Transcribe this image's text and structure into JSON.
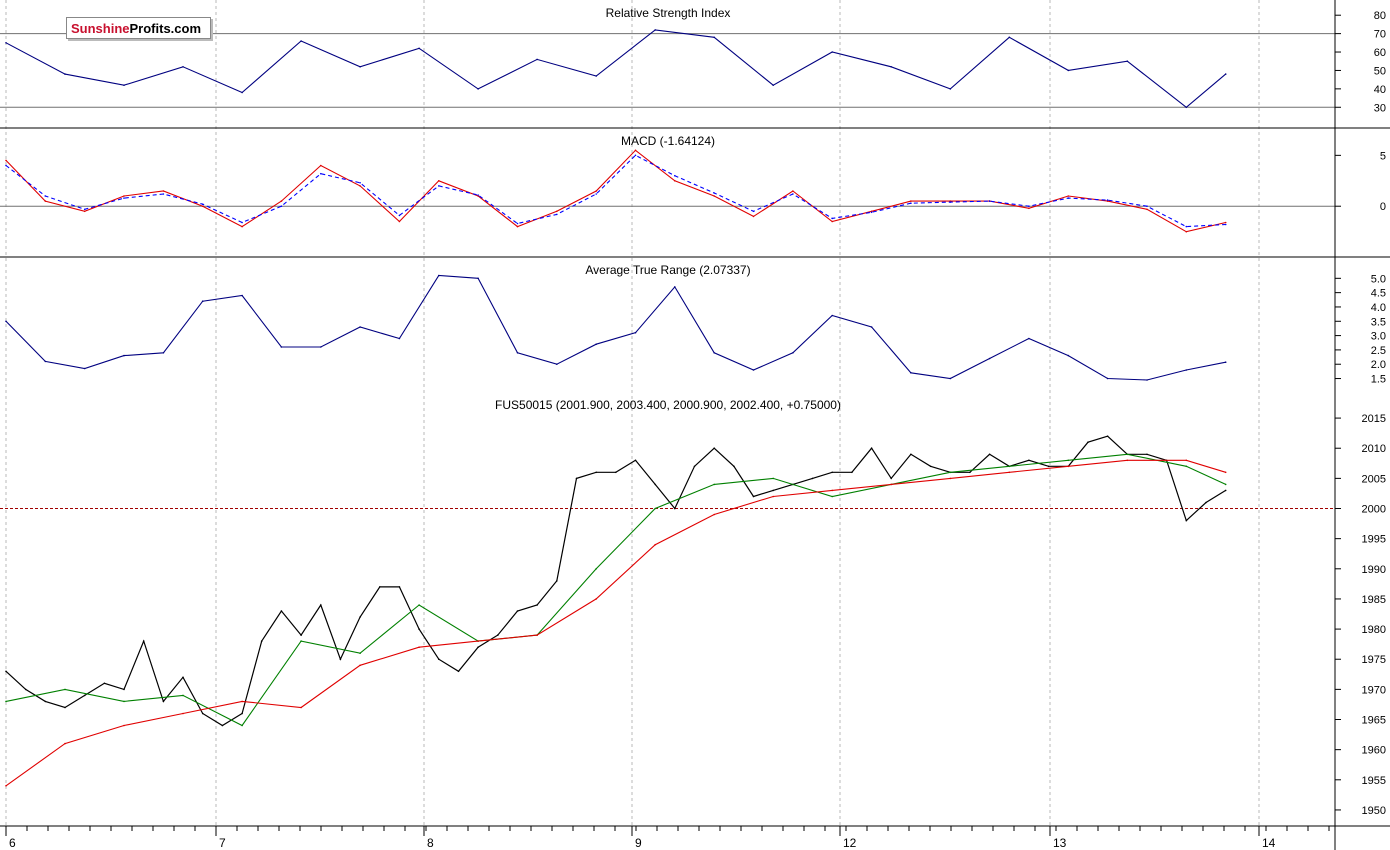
{
  "brand": {
    "part1": "Sunshine",
    "part2": "Profits.com"
  },
  "colors": {
    "price": "#000000",
    "sma_fast": "#008000",
    "sma_slow": "#e00000",
    "indicator": "#000080",
    "signal": "#0000ff",
    "grid": "#b8b8b8",
    "ref": "#707070",
    "hline": "#a00000"
  },
  "x_axis": {
    "labels": [
      "6",
      "7",
      "8",
      "9",
      "12",
      "13",
      "14"
    ]
  },
  "chart_data": [
    {
      "type": "line",
      "title": "Relative Strength Index",
      "ylim": [
        22,
        85
      ],
      "yticks": [
        30,
        40,
        50,
        60,
        70,
        80
      ],
      "reference_lines": [
        30,
        70
      ],
      "x": [
        0,
        3,
        6,
        9,
        12,
        15,
        18,
        21,
        24,
        27,
        30,
        33,
        36,
        39,
        42,
        45,
        48,
        51,
        54,
        57,
        60,
        62
      ],
      "values": [
        65,
        48,
        42,
        52,
        38,
        66,
        52,
        62,
        40,
        56,
        47,
        72,
        68,
        42,
        60,
        52,
        40,
        68,
        50,
        55,
        30,
        48
      ]
    },
    {
      "type": "line",
      "title": "MACD (-1.64124)",
      "ylim": [
        -4.5,
        7
      ],
      "yticks": [
        0,
        5
      ],
      "reference_lines": [
        0
      ],
      "series": [
        {
          "x": [
            0,
            2,
            4,
            6,
            8,
            10,
            12,
            14,
            16,
            18,
            20,
            22,
            24,
            26,
            28,
            30,
            32,
            34,
            36,
            38,
            40,
            42,
            44,
            46,
            48,
            50,
            52,
            54,
            56,
            58,
            60,
            62
          ],
          "values": [
            4.5,
            0.5,
            -0.5,
            1,
            1.5,
            0,
            -2,
            0.5,
            4,
            2,
            -1.5,
            2.5,
            1,
            -2,
            -0.5,
            1.5,
            5.5,
            2.5,
            1,
            -1,
            1.5,
            -1.5,
            -0.5,
            0.5,
            0.5,
            0.5,
            -0.2,
            1,
            0.5,
            -0.3,
            -2.5,
            -1.6
          ]
        },
        {
          "x": [
            0,
            2,
            4,
            6,
            8,
            10,
            12,
            14,
            16,
            18,
            20,
            22,
            24,
            26,
            28,
            30,
            32,
            34,
            36,
            38,
            40,
            42,
            44,
            46,
            48,
            50,
            52,
            54,
            56,
            58,
            60,
            62
          ],
          "values": [
            4,
            1,
            -0.3,
            0.8,
            1.2,
            0.2,
            -1.6,
            0,
            3.2,
            2.3,
            -0.9,
            2,
            1.1,
            -1.7,
            -0.8,
            1.2,
            5,
            3,
            1.3,
            -0.5,
            1.2,
            -1.2,
            -0.6,
            0.3,
            0.4,
            0.5,
            0,
            0.8,
            0.6,
            0,
            -2,
            -1.8
          ]
        }
      ]
    },
    {
      "type": "line",
      "title": "Average True Range (2.07337)",
      "ylim": [
        1.1,
        5.5
      ],
      "yticks": [
        1.5,
        2.0,
        2.5,
        3.0,
        3.5,
        4.0,
        4.5,
        5.0
      ],
      "x": [
        0,
        2,
        4,
        6,
        8,
        10,
        12,
        14,
        16,
        18,
        20,
        22,
        24,
        26,
        28,
        30,
        32,
        34,
        36,
        38,
        40,
        42,
        44,
        46,
        48,
        50,
        52,
        54,
        56,
        58,
        60,
        62
      ],
      "values": [
        3.5,
        2.1,
        1.85,
        2.3,
        2.4,
        4.2,
        4.4,
        2.6,
        2.6,
        3.3,
        2.9,
        5.1,
        5.0,
        2.4,
        2.0,
        2.7,
        3.1,
        4.7,
        2.4,
        1.8,
        2.4,
        3.7,
        3.3,
        1.7,
        1.5,
        2.2,
        2.9,
        2.3,
        1.5,
        1.45,
        1.8,
        2.07
      ]
    },
    {
      "type": "line",
      "title": "FUS50015 (2001.900, 2003.400, 2000.900, 2002.400, +0.75000)",
      "ylim": [
        1948,
        2018
      ],
      "yticks": [
        1950,
        1955,
        1960,
        1965,
        1970,
        1975,
        1980,
        1985,
        1990,
        1995,
        2000,
        2005,
        2010,
        2015
      ],
      "reference_lines": [
        2000
      ],
      "series": [
        {
          "x": [
            0,
            1,
            2,
            3,
            4,
            5,
            6,
            7,
            8,
            9,
            10,
            11,
            12,
            13,
            14,
            15,
            16,
            17,
            18,
            19,
            20,
            21,
            22,
            23,
            24,
            25,
            26,
            27,
            28,
            29,
            30,
            31,
            32,
            33,
            34,
            35,
            36,
            37,
            38,
            39,
            40,
            41,
            42,
            43,
            44,
            45,
            46,
            47,
            48,
            49,
            50,
            51,
            52,
            53,
            54,
            55,
            56,
            57,
            58,
            59,
            60,
            61,
            62
          ],
          "values": [
            1973,
            1970,
            1968,
            1967,
            1969,
            1971,
            1970,
            1978,
            1968,
            1972,
            1966,
            1964,
            1966,
            1978,
            1983,
            1979,
            1984,
            1975,
            1982,
            1987,
            1987,
            1980,
            1975,
            1973,
            1977,
            1979,
            1983,
            1984,
            1988,
            2005,
            2006,
            2006,
            2008,
            2004,
            2000,
            2007,
            2010,
            2007,
            2002,
            2003,
            2004,
            2005,
            2006,
            2006,
            2010,
            2005,
            2009,
            2007,
            2006,
            2006,
            2009,
            2007,
            2008,
            2007,
            2007,
            2011,
            2012,
            2009,
            2009,
            2008,
            1998,
            2001,
            2003
          ]
        },
        {
          "x": [
            0,
            3,
            6,
            9,
            12,
            15,
            18,
            21,
            24,
            27,
            30,
            33,
            36,
            39,
            42,
            45,
            48,
            51,
            54,
            57,
            60,
            62
          ],
          "values": [
            1968,
            1970,
            1968,
            1969,
            1964,
            1978,
            1976,
            1984,
            1978,
            1979,
            1990,
            2000,
            2004,
            2005,
            2002,
            2004,
            2006,
            2007,
            2008,
            2009,
            2007,
            2004
          ]
        },
        {
          "x": [
            0,
            3,
            6,
            9,
            12,
            15,
            18,
            21,
            24,
            27,
            30,
            33,
            36,
            39,
            42,
            45,
            48,
            51,
            54,
            57,
            60,
            62
          ],
          "values": [
            1954,
            1961,
            1964,
            1966,
            1968,
            1967,
            1974,
            1977,
            1978,
            1979,
            1985,
            1994,
            1999,
            2002,
            2003,
            2004,
            2005,
            2006,
            2007,
            2008,
            2008,
            2006
          ]
        }
      ]
    }
  ]
}
